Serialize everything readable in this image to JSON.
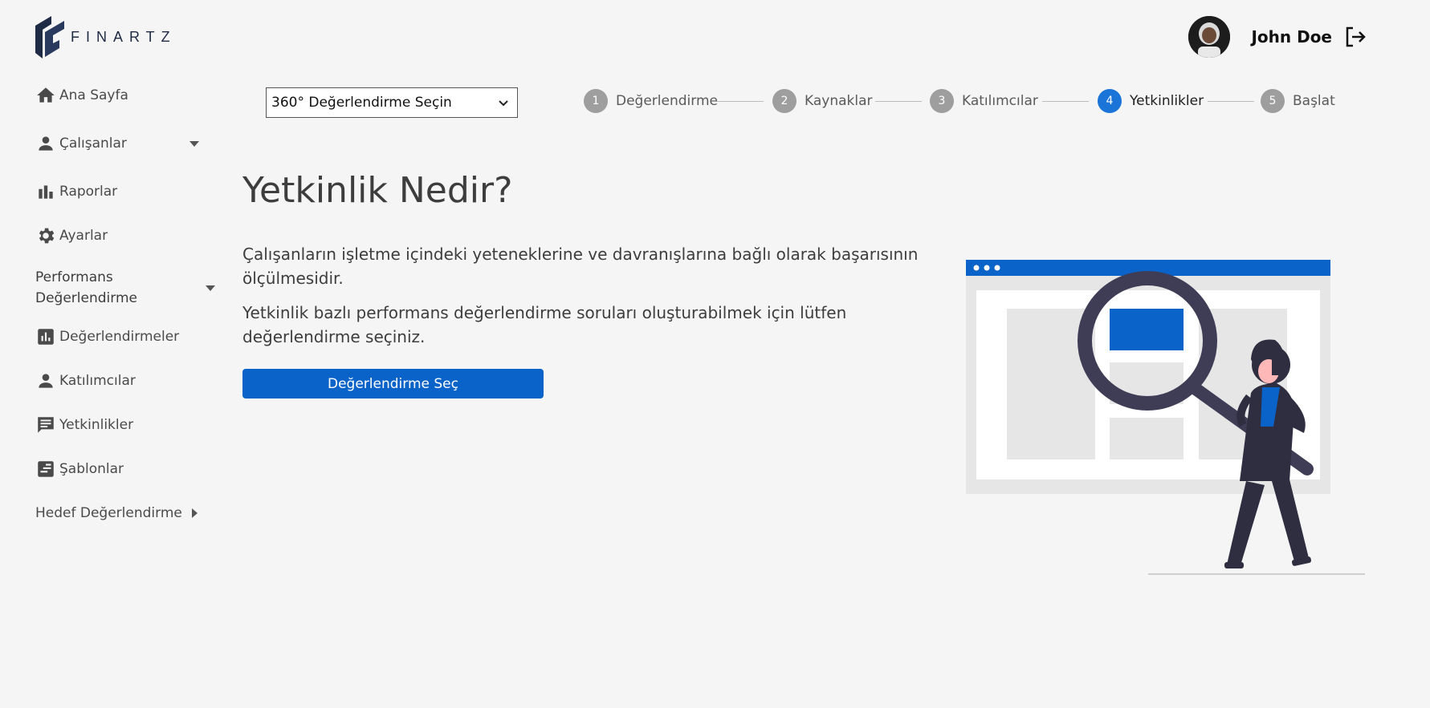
{
  "header": {
    "brand": "FINARTZ",
    "user_name": "John Doe",
    "logo_icon": "finartz-logo-icon",
    "logout_icon": "logout-icon"
  },
  "sidebar": {
    "home": {
      "label": "Ana Sayfa",
      "icon": "home-icon"
    },
    "employees": {
      "label": "Çalışanlar",
      "icon": "person-icon"
    },
    "reports": {
      "label": "Raporlar",
      "icon": "bar-chart-icon"
    },
    "settings": {
      "label": "Ayarlar",
      "icon": "gear-icon"
    },
    "performance": {
      "line1": "Performans",
      "line2": "Değerlendirme",
      "items": [
        {
          "label": "Değerlendirmeler",
          "icon": "chart-square-icon"
        },
        {
          "label": "Katılımcılar",
          "icon": "person-icon"
        },
        {
          "label": "Yetkinlikler",
          "icon": "message-icon"
        },
        {
          "label": "Şablonlar",
          "icon": "template-icon"
        }
      ]
    },
    "goal_eval": {
      "label": "Hedef Değerlendirme"
    }
  },
  "evaluation_select": {
    "value": "360° Değerlendirme Seçin"
  },
  "stepper": {
    "steps": [
      {
        "number": "1",
        "label": "Değerlendirme"
      },
      {
        "number": "2",
        "label": "Kaynaklar"
      },
      {
        "number": "3",
        "label": "Katılımcılar"
      },
      {
        "number": "4",
        "label": "Yetkinlikler"
      },
      {
        "number": "5",
        "label": "Başlat"
      }
    ],
    "active_step": 4
  },
  "main": {
    "title": "Yetkinlik Nedir?",
    "paragraph1": "Çalışanların işletme içindeki yeteneklerine ve davranışlarına bağlı olarak başarısının ölçülmesidir.",
    "paragraph2": "Yetkinlik bazlı performans değerlendirme soruları oluşturabilmek için lütfen değerlendirme seçiniz.",
    "button_label": "Değerlendirme Seç"
  },
  "colors": {
    "primary": "#0a63c9",
    "active_step": "#1b74d8",
    "inactive_step": "#9e9e9e",
    "background": "#f5f5f5",
    "text": "#3d3d3d"
  }
}
